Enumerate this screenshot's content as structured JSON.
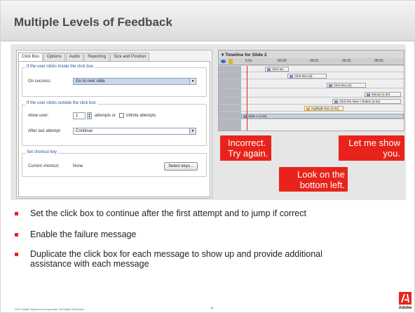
{
  "slide": {
    "title": "Multiple Levels of Feedback",
    "page_number": "11",
    "copyright": "2007 Adobe Systems Incorporated.  All Rights Reserved.",
    "logo_text": "Adobe",
    "accent_color": "#e8231b"
  },
  "dialog": {
    "tabs": [
      {
        "label": "Click Box",
        "active": true
      },
      {
        "label": "Options",
        "active": false
      },
      {
        "label": "Audio",
        "active": false
      },
      {
        "label": "Reporting",
        "active": false
      },
      {
        "label": "Size and Position",
        "active": false
      }
    ],
    "inside_group": {
      "title": "If the user clicks inside the click box",
      "on_success_label": "On success:",
      "on_success_value": "Go to next slide"
    },
    "outside_group": {
      "title": "If the user clicks outside the click box",
      "allow_user_label": "Allow user:",
      "attempts_value": "1",
      "attempts_label": "attempts or",
      "infinite_label": "Infinite attempts",
      "after_last_label": "After last attempt:",
      "after_last_value": "Continue"
    },
    "shortcut_group": {
      "title": "Set shortcut key",
      "current_label": "Current shortcut:",
      "current_value": "None",
      "select_keys_label": "Select keys..."
    }
  },
  "timeline": {
    "title": "Timeline for Slide 2",
    "ruler": [
      "0.0s",
      "00:00",
      "00:01",
      "00:02",
      "00:03"
    ],
    "items": [
      {
        "label": "Click Bo",
        "icon": "click-box-icon"
      },
      {
        "label": "Click Box (8)",
        "icon": "click-box-icon"
      },
      {
        "label": "Click Box (2)",
        "icon": "click-box-icon"
      },
      {
        "label": "Mouse (1.6s)",
        "icon": "mouse-icon"
      },
      {
        "label": "Click the Next > button (2.0s)",
        "icon": "caption-icon"
      },
      {
        "label": "Highlight Box (2.5s)",
        "icon": "highlight-icon"
      },
      {
        "label": "Slide 2 (4.5s)",
        "icon": "slide-icon"
      }
    ]
  },
  "callouts": {
    "incorrect": {
      "line1": "Incorrect.",
      "line2": "Try again."
    },
    "show_you": {
      "line1": "Let me show",
      "line2": "you."
    },
    "look": {
      "line1": "Look on the",
      "line2": "bottom left."
    }
  },
  "bullets": [
    "Set the click box to continue after the first attempt and to jump if correct",
    "Enable the failure message",
    "Duplicate the click box for each message to show up and provide additional",
    "assistance with each message"
  ]
}
